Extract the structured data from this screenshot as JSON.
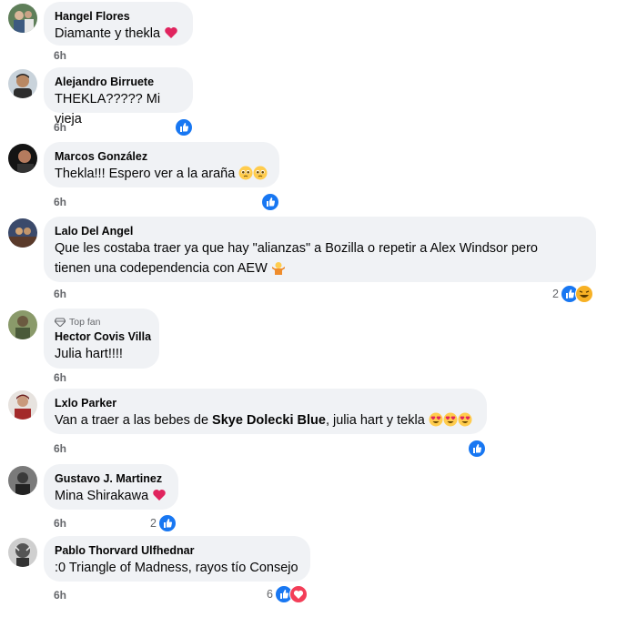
{
  "comments": [
    {
      "author": "Hangel Flores",
      "text": "Diamante y thekla",
      "emoji": [
        "heart"
      ],
      "time": "6h"
    },
    {
      "author": "Alejandro Birruete",
      "text": "THEKLA????? Mi vieja",
      "time": "6h",
      "reactions": [
        "like"
      ]
    },
    {
      "author": "Marcos González",
      "text": "Thekla!!! Espero ver a la araña",
      "emoji": [
        "pleading-face",
        "pleading-face"
      ],
      "time": "6h",
      "reactions": [
        "like"
      ]
    },
    {
      "author": "Lalo Del Angel",
      "text_line1": "Que les costaba traer ya que hay \"alianzas\" a Bozilla o repetir a Alex Windsor pero",
      "text_line2": "tienen una codependencia con AEW",
      "emoji": [
        "person-shrugging"
      ],
      "time": "6h",
      "reaction_count": "2",
      "reactions": [
        "like",
        "laughing"
      ]
    },
    {
      "badge": "Top fan",
      "author": "Hector Covis Villa",
      "text": "Julia hart!!!!",
      "time": "6h"
    },
    {
      "author": "Lxlo Parker",
      "text_before": "Van a traer a las bebes de ",
      "mention": "Skye Dolecki Blue",
      "text_after": ", julia hart y tekla",
      "emoji": [
        "heart-eyes",
        "heart-eyes",
        "heart-eyes"
      ],
      "time": "6h",
      "reactions": [
        "like"
      ]
    },
    {
      "author": "Gustavo J. Martinez",
      "text": "Mina Shirakawa",
      "emoji": [
        "heart"
      ],
      "time": "6h",
      "reaction_count": "2",
      "reactions": [
        "like"
      ]
    },
    {
      "author": "Pablo Thorvard Ulfhednar",
      "text": ":0 Triangle of Madness, rayos tío Consejo",
      "time": "6h",
      "reaction_count": "6",
      "reactions": [
        "like",
        "love"
      ]
    }
  ],
  "colors": {
    "bubble": "#f0f2f5",
    "like": "#1877f2",
    "love": "#f33e58",
    "haha": "#f7b125",
    "meta": "#65676b"
  }
}
